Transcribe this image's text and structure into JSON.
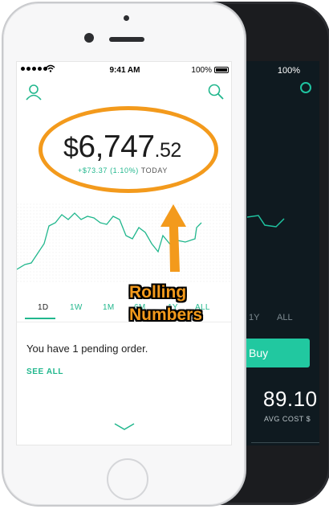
{
  "front": {
    "status": {
      "time": "9:41 AM",
      "battery": "100%"
    },
    "balance": {
      "currency": "$",
      "whole": "6,747",
      "cents": ".52"
    },
    "change": {
      "value": "+$73.37 (1.10%)",
      "period": "TODAY"
    },
    "timeframes": [
      "1D",
      "1W",
      "1M",
      "6M",
      "1Y",
      "ALL"
    ],
    "active_timeframe": "1D",
    "pending_text": "You have 1 pending order.",
    "see_all_label": "SEE ALL",
    "colors": {
      "accent": "#21b78d",
      "annotation": "#f39a1c"
    }
  },
  "back": {
    "status": {
      "battery": "100%"
    },
    "timeframes": [
      "1Y",
      "ALL"
    ],
    "buy_label": "Buy",
    "stat_value": "89.10",
    "stat_label": "AVG COST $"
  },
  "annotation": {
    "label_line1": "Rolling",
    "label_line2": "Numbers"
  },
  "icons": [
    "profile-icon",
    "search-icon",
    "wifi-icon",
    "battery-icon",
    "chevron-down-icon",
    "arrow-up-icon"
  ]
}
